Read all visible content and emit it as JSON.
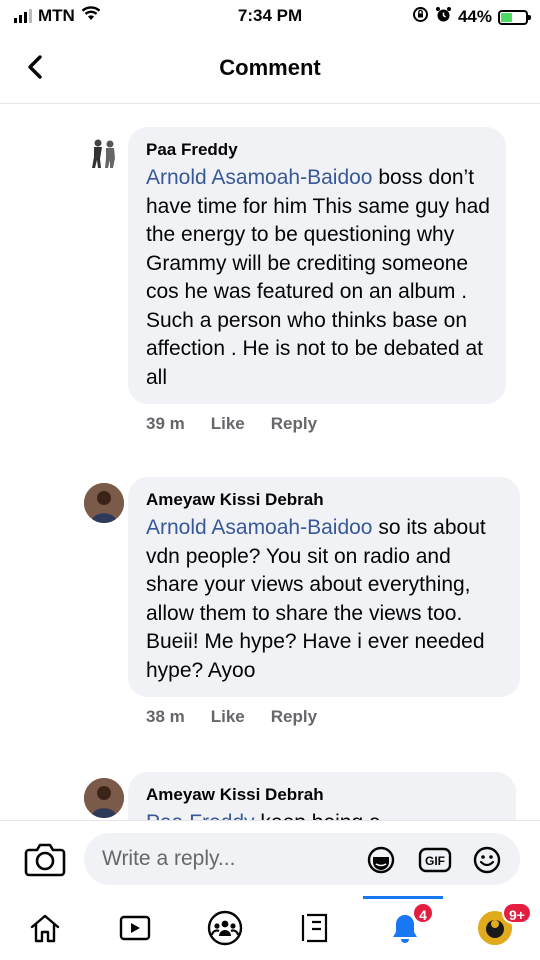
{
  "status_bar": {
    "carrier": "MTN",
    "time": "7:34 PM",
    "battery_percent": "44%",
    "battery_level": 0.44
  },
  "header": {
    "title": "Comment",
    "back_icon": "chevron-left-icon"
  },
  "comments": [
    {
      "author": "Paa Freddy",
      "mention": "Arnold Asamoah-Baidoo",
      "text": " boss don’t have time for him This same guy had the energy to be questioning why Grammy will be crediting someone cos he was featured on an album . Such a person who thinks base on affection . He is not to be debated at all",
      "time": "39 m",
      "like_label": "Like",
      "reply_label": "Reply"
    },
    {
      "author": "Ameyaw Kissi Debrah",
      "mention": "Arnold Asamoah-Baidoo",
      "text": " so its about vdn people? You sit on radio and share your views about everything,  allow them to share the views too. Bueii! Me hype? Have i ever needed hype? Ayoo",
      "time": "38 m",
      "like_label": "Like",
      "reply_label": "Reply"
    },
    {
      "author": "Ameyaw Kissi Debrah",
      "mention": "Paa Freddy",
      "text": " keep being a"
    }
  ],
  "reply_bar": {
    "placeholder": "Write a reply...",
    "icons": [
      "camera-icon",
      "sticker-icon",
      "gif-icon",
      "emoji-icon"
    ]
  },
  "bottom_nav": {
    "items": [
      "home-icon",
      "video-icon",
      "groups-icon",
      "news-icon",
      "notifications-icon",
      "menu-icon"
    ],
    "notifications_badge": "4",
    "menu_badge": "9+",
    "active": "notifications-icon"
  },
  "colors": {
    "mention": "#385898",
    "bubble": "#f0f2f5",
    "meta": "#65676b",
    "accent": "#1877f2",
    "badge": "#e41e3f"
  }
}
